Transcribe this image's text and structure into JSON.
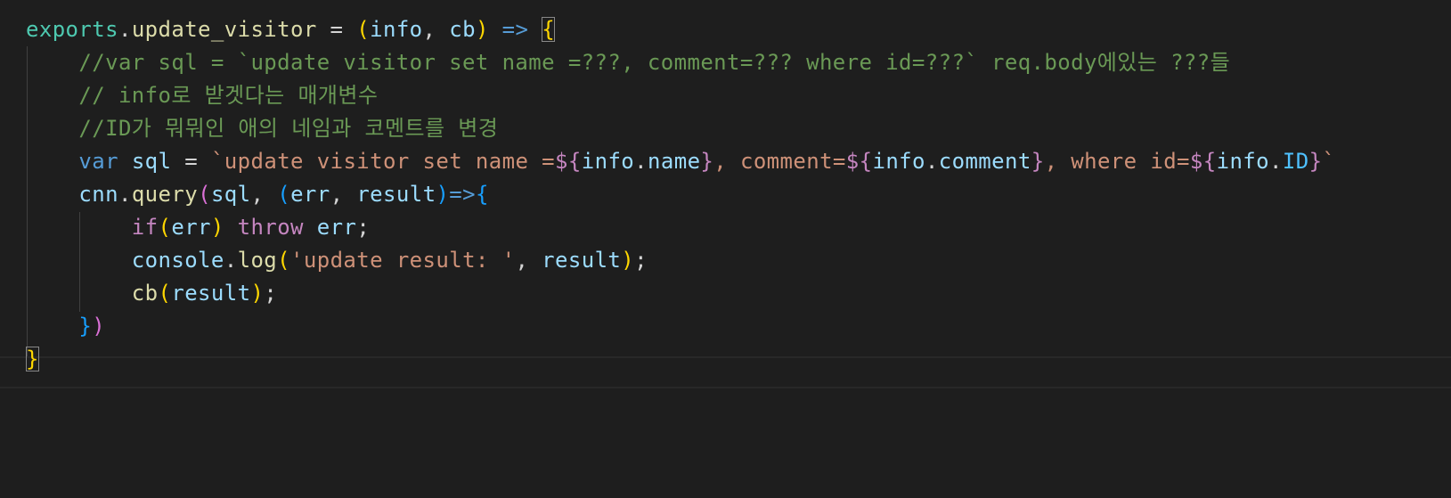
{
  "editor": {
    "language": "javascript",
    "theme": "dark",
    "lines": [
      [
        {
          "t": "exports",
          "c": "t-var"
        },
        {
          "t": ".",
          "c": "t-plain"
        },
        {
          "t": "update_visitor",
          "c": "t-fn"
        },
        {
          "t": " = ",
          "c": "t-plain"
        },
        {
          "t": "(",
          "c": "b1"
        },
        {
          "t": "info",
          "c": "t-param"
        },
        {
          "t": ", ",
          "c": "t-plain"
        },
        {
          "t": "cb",
          "c": "t-param"
        },
        {
          "t": ")",
          "c": "b1"
        },
        {
          "t": " ",
          "c": "t-plain"
        },
        {
          "t": "=>",
          "c": "t-kw"
        },
        {
          "t": " ",
          "c": "t-plain"
        },
        {
          "t": "{",
          "c": "b1 bracket-box"
        }
      ],
      [
        {
          "t": "    ",
          "c": "t-plain"
        },
        {
          "t": "//var sql = `update visitor set name =???, comment=??? where id=???` req.body에있는 ???들",
          "c": "t-cmt"
        }
      ],
      [
        {
          "t": "    ",
          "c": "t-plain"
        },
        {
          "t": "// info로 받겟다는 매개변수",
          "c": "t-cmt"
        }
      ],
      [
        {
          "t": "    ",
          "c": "t-plain"
        },
        {
          "t": "//ID가 뭐뭐인 애의 네임과 코멘트를 변경",
          "c": "t-cmt"
        }
      ],
      [
        {
          "t": "    ",
          "c": "t-plain"
        },
        {
          "t": "var",
          "c": "t-kw"
        },
        {
          "t": " ",
          "c": "t-plain"
        },
        {
          "t": "sql",
          "c": "t-param"
        },
        {
          "t": " = ",
          "c": "t-plain"
        },
        {
          "t": "`update visitor set name =",
          "c": "t-str"
        },
        {
          "t": "${",
          "c": "t-ctrl"
        },
        {
          "t": "info",
          "c": "t-param"
        },
        {
          "t": ".",
          "c": "t-plain"
        },
        {
          "t": "name",
          "c": "t-param"
        },
        {
          "t": "}",
          "c": "t-ctrl"
        },
        {
          "t": ", comment=",
          "c": "t-str"
        },
        {
          "t": "${",
          "c": "t-ctrl"
        },
        {
          "t": "info",
          "c": "t-param"
        },
        {
          "t": ".",
          "c": "t-plain"
        },
        {
          "t": "comment",
          "c": "t-param"
        },
        {
          "t": "}",
          "c": "t-ctrl"
        },
        {
          "t": ", where id=",
          "c": "t-str"
        },
        {
          "t": "${",
          "c": "t-ctrl"
        },
        {
          "t": "info",
          "c": "t-param"
        },
        {
          "t": ".",
          "c": "t-plain"
        },
        {
          "t": "ID",
          "c": "t-const"
        },
        {
          "t": "}",
          "c": "t-ctrl"
        },
        {
          "t": "`",
          "c": "t-str"
        }
      ],
      [
        {
          "t": "    ",
          "c": "t-plain"
        },
        {
          "t": "cnn",
          "c": "t-param"
        },
        {
          "t": ".",
          "c": "t-plain"
        },
        {
          "t": "query",
          "c": "t-fn"
        },
        {
          "t": "(",
          "c": "b2"
        },
        {
          "t": "sql",
          "c": "t-param"
        },
        {
          "t": ", ",
          "c": "t-plain"
        },
        {
          "t": "(",
          "c": "b3"
        },
        {
          "t": "err",
          "c": "t-param"
        },
        {
          "t": ", ",
          "c": "t-plain"
        },
        {
          "t": "result",
          "c": "t-param"
        },
        {
          "t": ")",
          "c": "b3"
        },
        {
          "t": "=>",
          "c": "t-kw"
        },
        {
          "t": "{",
          "c": "b3"
        }
      ],
      [
        {
          "t": "        ",
          "c": "t-plain"
        },
        {
          "t": "if",
          "c": "t-ctrl"
        },
        {
          "t": "(",
          "c": "b1"
        },
        {
          "t": "err",
          "c": "t-param"
        },
        {
          "t": ")",
          "c": "b1"
        },
        {
          "t": " ",
          "c": "t-plain"
        },
        {
          "t": "throw",
          "c": "t-ctrl"
        },
        {
          "t": " ",
          "c": "t-plain"
        },
        {
          "t": "err",
          "c": "t-param"
        },
        {
          "t": ";",
          "c": "t-plain"
        }
      ],
      [
        {
          "t": "        ",
          "c": "t-plain"
        },
        {
          "t": "console",
          "c": "t-param"
        },
        {
          "t": ".",
          "c": "t-plain"
        },
        {
          "t": "log",
          "c": "t-fn"
        },
        {
          "t": "(",
          "c": "b1"
        },
        {
          "t": "'update result: '",
          "c": "t-str"
        },
        {
          "t": ", ",
          "c": "t-plain"
        },
        {
          "t": "result",
          "c": "t-param"
        },
        {
          "t": ")",
          "c": "b1"
        },
        {
          "t": ";",
          "c": "t-plain"
        }
      ],
      [
        {
          "t": "        ",
          "c": "t-plain"
        },
        {
          "t": "cb",
          "c": "t-fn"
        },
        {
          "t": "(",
          "c": "b1"
        },
        {
          "t": "result",
          "c": "t-param"
        },
        {
          "t": ")",
          "c": "b1"
        },
        {
          "t": ";",
          "c": "t-plain"
        }
      ],
      [
        {
          "t": "    ",
          "c": "t-plain"
        },
        {
          "t": "}",
          "c": "b3"
        },
        {
          "t": ")",
          "c": "b2"
        }
      ],
      [
        {
          "t": "}",
          "c": "b1 bracket-box"
        }
      ]
    ]
  }
}
